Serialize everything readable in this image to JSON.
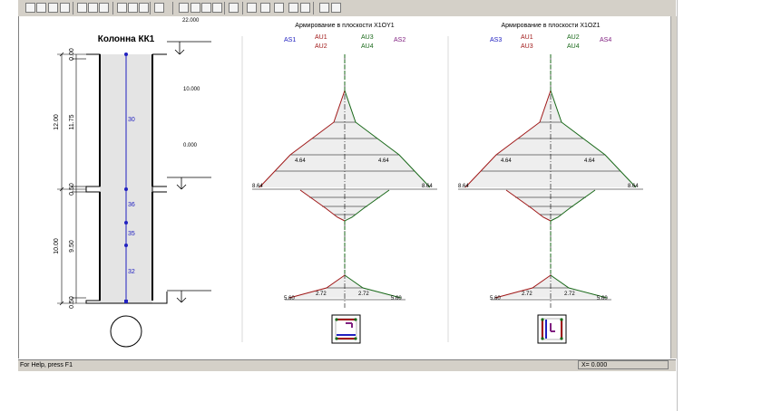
{
  "toolbar": {
    "buttons": [
      "new-icon",
      "open-icon",
      "save-icon",
      "save-all-icon",
      "cut-icon",
      "copy-icon",
      "paste-icon",
      "print-icon",
      "zoom-in-icon",
      "zoom-out-icon",
      "pencil-icon",
      "tool-icon",
      "tool-icon",
      "tool-icon",
      "text-icon",
      "check-icon",
      "section-icon",
      "page-icon",
      "chart-icon",
      "mirror-icon",
      "list-icon",
      "help-icon",
      "context-help-icon"
    ]
  },
  "column": {
    "title": "Колонна КК1",
    "top_level": "22.000",
    "level_mid": "10.000",
    "level_zero": "0.000",
    "dims_outer": [
      "12.00",
      "10.00"
    ],
    "dims_inner": [
      "0.00",
      "11.75",
      "0.50",
      "9.50",
      "0.50"
    ],
    "rebar_labels": [
      "30",
      "36",
      "35",
      "32"
    ]
  },
  "diagram_y": {
    "title": "Армирование в плоскости X1OY1",
    "labels": [
      "AS1",
      "AU1",
      "AU2",
      "AU3",
      "AU4",
      "AS2"
    ],
    "upper": {
      "left": "8.64",
      "right": "8.64",
      "mid_left": "4.64",
      "mid_right": "4.64"
    },
    "lower": {
      "left": "5.60",
      "right": "5.60",
      "mid_left": "2.72",
      "mid_right": "2.72"
    }
  },
  "diagram_z": {
    "title": "Армирование в плоскости X1OZ1",
    "labels": [
      "AS3",
      "AU1",
      "AU3",
      "AU2",
      "AU4",
      "AS4"
    ],
    "upper": {
      "left": "8.64",
      "right": "8.64",
      "mid_left": "4.64",
      "mid_right": "4.64"
    },
    "lower": {
      "left": "5.60",
      "right": "5.60",
      "mid_left": "2.72",
      "mid_right": "2.72"
    }
  },
  "colors": {
    "red": "#a01818",
    "green": "#186818",
    "blue": "#2020c0",
    "purple": "#802080",
    "fill": "#eeeeee"
  },
  "status": {
    "help": "For Help, press F1",
    "coord": "X= 0.000"
  }
}
